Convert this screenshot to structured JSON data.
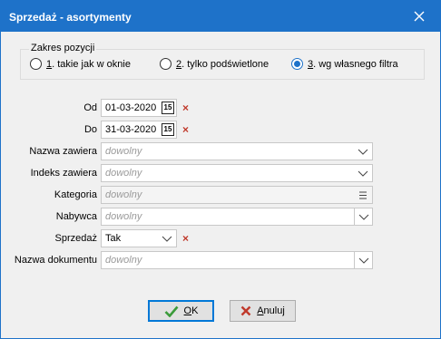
{
  "window": {
    "title": "Sprzedaż - asortymenty"
  },
  "scope": {
    "legend": "Zakres pozycji",
    "options": [
      {
        "key": "1",
        "label": ". takie jak w oknie",
        "checked": false
      },
      {
        "key": "2",
        "label": ". tylko podświetlone",
        "checked": false
      },
      {
        "key": "3",
        "label": ". wg własnego filtra",
        "checked": true
      }
    ]
  },
  "filters": {
    "date_from": {
      "label": "Od",
      "value": "01-03-2020",
      "cal_icon": "15"
    },
    "date_to": {
      "label": "Do",
      "value": "31-03-2020",
      "cal_icon": "15"
    },
    "contains_name": {
      "label": "Nazwa zawiera",
      "placeholder": "dowolny"
    },
    "contains_index": {
      "label": "Indeks zawiera",
      "placeholder": "dowolny"
    },
    "category": {
      "label": "Kategoria",
      "placeholder": "dowolny"
    },
    "buyer": {
      "label": "Nabywca",
      "placeholder": "dowolny"
    },
    "sale": {
      "label": "Sprzedaż",
      "value": "Tak"
    },
    "doc_name": {
      "label": "Nazwa dokumentu",
      "placeholder": "dowolny"
    }
  },
  "buttons": {
    "ok": {
      "mnemonic": "O",
      "rest": "K"
    },
    "cancel": {
      "mnemonic": "A",
      "rest": "nuluj"
    }
  },
  "colors": {
    "titlebar": "#1e72c9",
    "clear_x": "#c0392b",
    "ok_check": "#3a9b3a"
  }
}
